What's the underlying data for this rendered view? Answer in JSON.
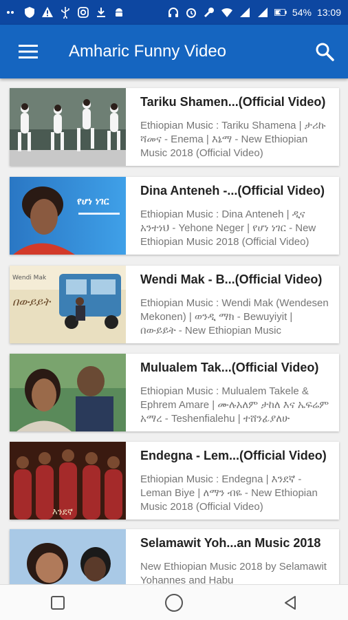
{
  "status_bar": {
    "battery": "54%",
    "time": "13:09"
  },
  "app_bar": {
    "title": "Amharic Funny Video",
    "menu_icon": "hamburger-menu-icon",
    "search_icon": "search-icon"
  },
  "videos": [
    {
      "title": "Tariku Shamen...(Official Video)",
      "description": "Ethiopian Music : Tariku Shamena | ታሪኩ ሻመና - Enema | እኔማ - New Ethiopian Music 2018 (Official Video)"
    },
    {
      "title": "Dina Anteneh -...(Official Video)",
      "description": "Ethiopian Music : Dina Anteneh | ዲና አንተነህ - Yehone Neger | የሆነ ነገር - New Ethiopian Music 2018 (Official Video)"
    },
    {
      "title": "Wendi Mak - B...(Official Video)",
      "description": "Ethiopian Music : Wendi Mak (Wendesen Mekonen) | ወንዲ ማክ - Bewuyiyit | በውይይት - New Ethiopian Music"
    },
    {
      "title": "Mulualem Tak...(Official Video)",
      "description": "Ethiopian Music : Mulualem Takele & Ephrem Amare | ሙሉአለም ታከለ እና ኤፍሬም አማረ - Teshenfialehu | ተሸንፊያለሁ"
    },
    {
      "title": "Endegna - Lem...(Official Video)",
      "description": "Ethiopian Music : Endegna | እንደኛ - Leman Biye | ለማን ብዬ - New Ethiopian Music 2018 (Official Video)"
    },
    {
      "title": "Selamawit Yoh...an Music 2018",
      "description": "New Ethiopian Music 2018 by Selamawit Yohannes and Habu"
    }
  ],
  "thumb_text": {
    "v2": "የሆነ ነገር",
    "v3": "በውይይት",
    "v3_artist": "Wendi Mak",
    "v5": "እንደኛ"
  },
  "colors": {
    "status_bar": "#0d47a1",
    "app_bar": "#1565c0",
    "title_text": "#222222",
    "description_text": "#757575"
  }
}
